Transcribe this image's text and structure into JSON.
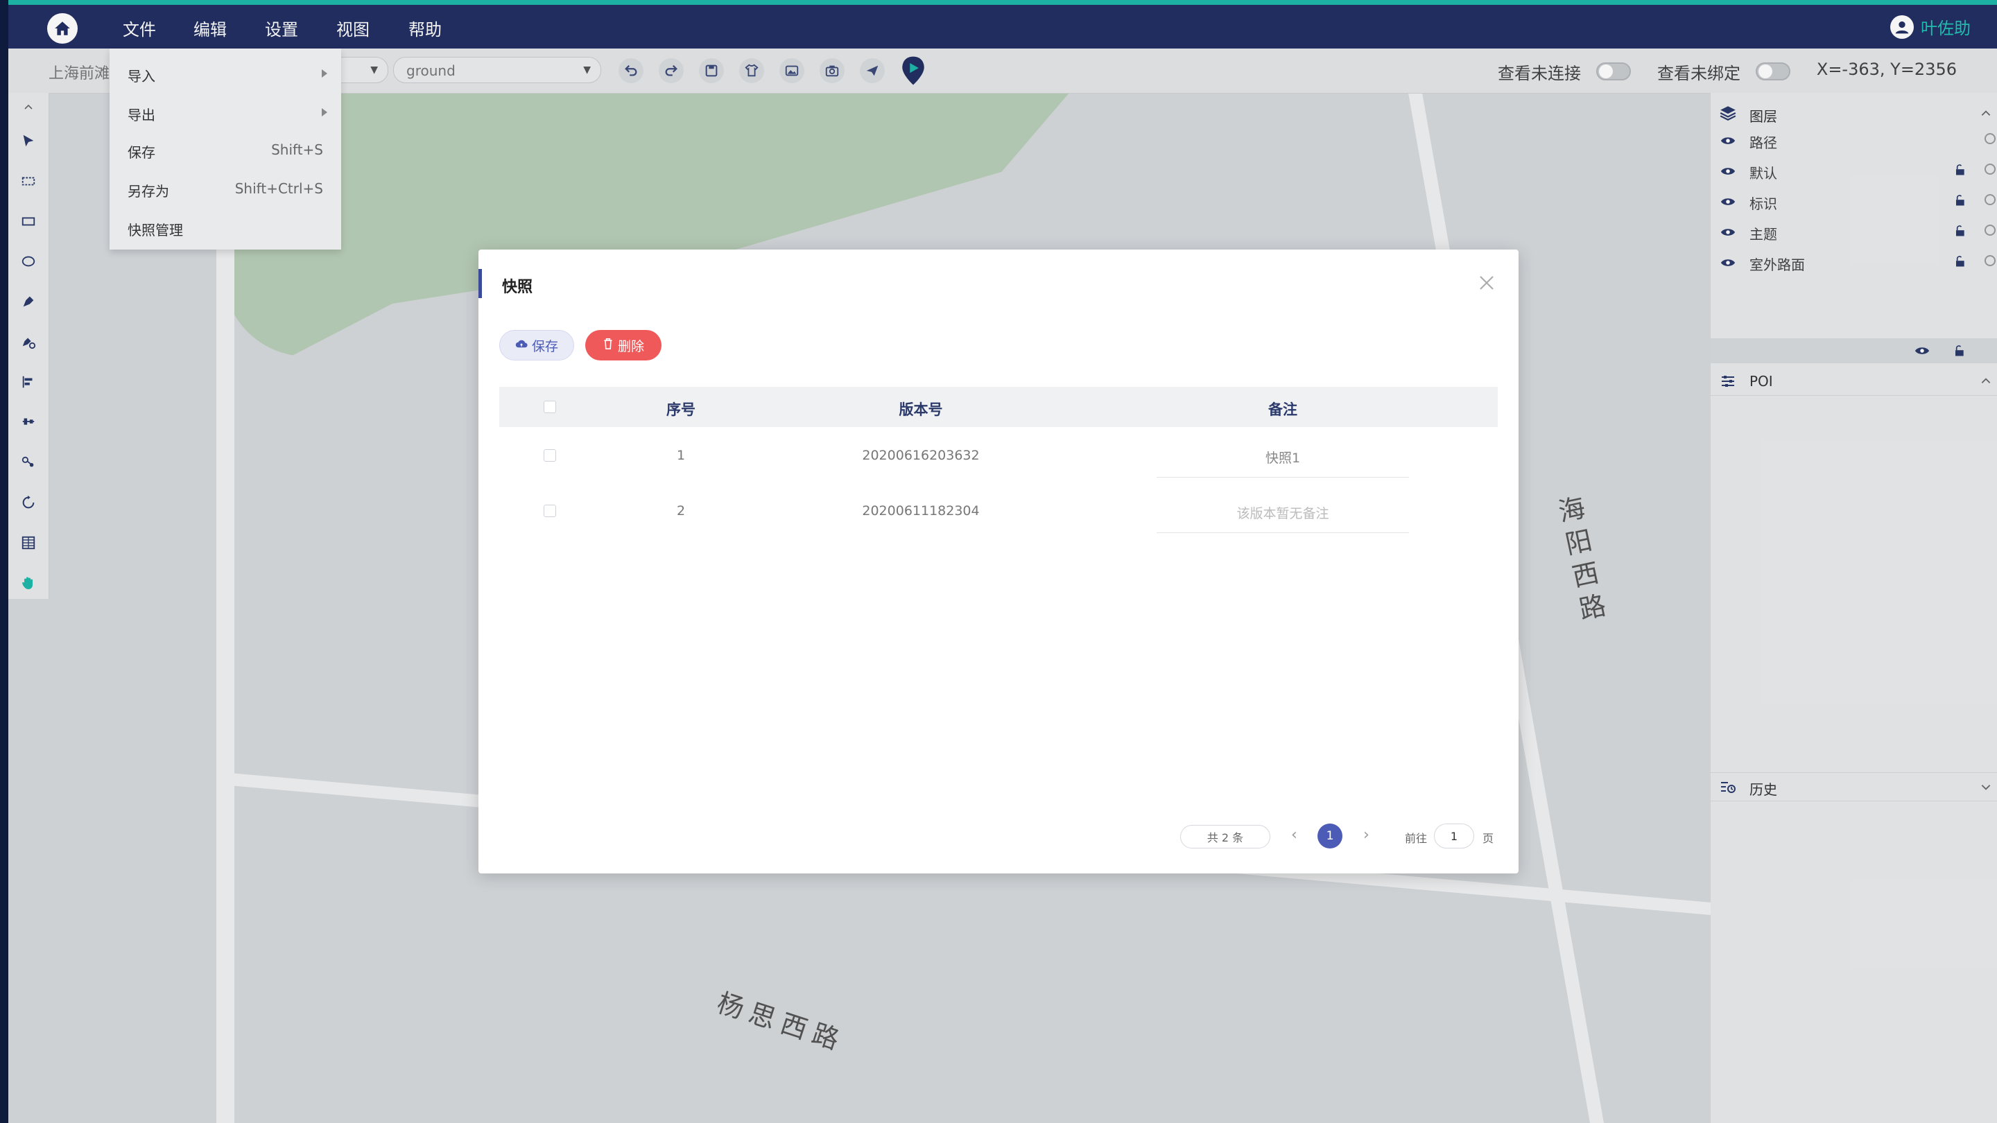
{
  "menubar": {
    "items": [
      "文件",
      "编辑",
      "设置",
      "视图",
      "帮助"
    ],
    "user": "叶佐助"
  },
  "toolbar": {
    "project_prefix": "上海前滩",
    "floor_select": "ground",
    "toggle_unconnected": "查看未连接",
    "toggle_unbound": "查看未绑定",
    "coords": "X=-363, Y=2356"
  },
  "file_menu": {
    "items": [
      {
        "label": "导入",
        "shortcut": ""
      },
      {
        "label": "导出",
        "shortcut": ""
      },
      {
        "label": "保存",
        "shortcut": "Shift+S"
      },
      {
        "label": "另存为",
        "shortcut": "Shift+Ctrl+S"
      },
      {
        "label": "快照管理",
        "shortcut": ""
      }
    ]
  },
  "layers_panel": {
    "title": "图层",
    "items": [
      "路径",
      "默认",
      "标识",
      "主题",
      "室外路面"
    ]
  },
  "poi_panel": {
    "title": "POI"
  },
  "history_panel": {
    "title": "历史"
  },
  "map": {
    "street_1": "杨思西路",
    "street_2": "海阳西路"
  },
  "dialog": {
    "title": "快照",
    "save_label": "保存",
    "delete_label": "删除",
    "columns": [
      "序号",
      "版本号",
      "备注"
    ],
    "rows": [
      {
        "index": "1",
        "version": "20200616203632",
        "note": "快照1"
      },
      {
        "index": "2",
        "version": "20200611182304",
        "note": "该版本暂无备注"
      }
    ],
    "pager": {
      "total": "共 2 条",
      "current": "1",
      "goto_label": "前往",
      "goto_value": "1",
      "page_suffix": "页"
    }
  },
  "colors": {
    "topbar": "#232f63",
    "accent": "#1fb9aa",
    "primary": "#4c5bb5",
    "danger": "#f0595a"
  }
}
